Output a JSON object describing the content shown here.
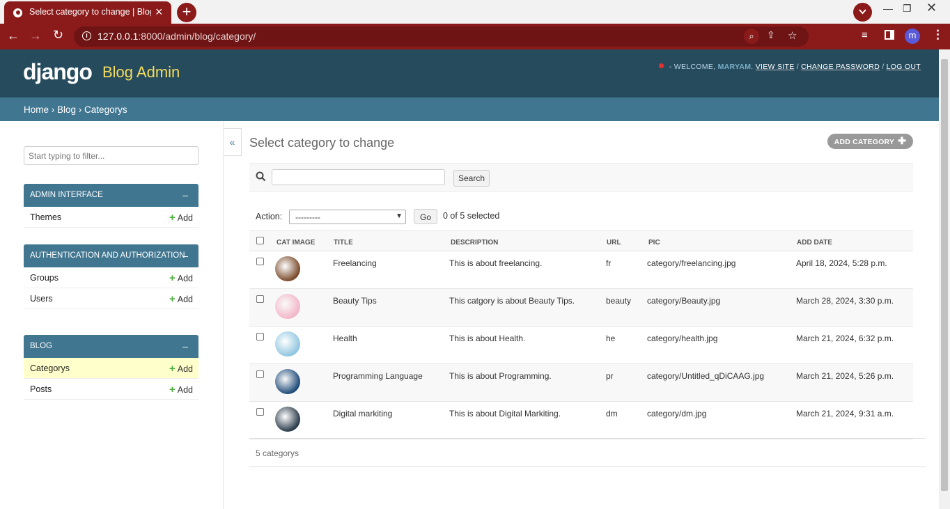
{
  "browser": {
    "tab_title": "Select category to change | Blog",
    "url_host": "127.0.0.1",
    "url_rest": ":8000/admin/blog/category/",
    "profile_initial": "m"
  },
  "header": {
    "brand": "django",
    "site_title": "Blog Admin",
    "welcome": "- Welcome,",
    "username": "maryam",
    "view_site": "View site",
    "change_password": "Change password",
    "logout": "Log out"
  },
  "breadcrumb": {
    "home": "Home",
    "app": "Blog",
    "current": "Categorys"
  },
  "sidebar": {
    "filter_placeholder": "Start typing to filter...",
    "add_label": "Add",
    "modules": [
      {
        "title": "ADMIN INTERFACE",
        "items": [
          "Themes"
        ]
      },
      {
        "title": "AUTHENTICATION AND AUTHORIZATION",
        "items": [
          "Groups",
          "Users"
        ]
      },
      {
        "title": "BLOG",
        "items": [
          "Categorys",
          "Posts"
        ]
      }
    ],
    "collapse": "«"
  },
  "content": {
    "title": "Select category to change",
    "add_button": "ADD CATEGORY",
    "search_button": "Search",
    "action_label": "Action:",
    "action_value": "---------",
    "go_button": "Go",
    "selected_count": "0 of 5 selected",
    "columns": [
      "CAT IMAGE",
      "TITLE",
      "DESCRIPTION",
      "URL",
      "PIC",
      "ADD DATE"
    ],
    "rows": [
      {
        "title": "Freelancing",
        "description": "This is about freelancing.",
        "url": "fr",
        "pic": "category/freelancing.jpg",
        "date": "April 18, 2024, 5:28 p.m.",
        "img_color": "#7a4a2a"
      },
      {
        "title": "Beauty Tips",
        "description": "This catgory is about Beauty Tips.",
        "url": "beauty",
        "pic": "category/Beauty.jpg",
        "date": "March 28, 2024, 3:30 p.m.",
        "img_color": "#f2b6c8"
      },
      {
        "title": "Health",
        "description": "This is about Health.",
        "url": "he",
        "pic": "category/health.jpg",
        "date": "March 21, 2024, 6:32 p.m.",
        "img_color": "#8fc6e0"
      },
      {
        "title": "Programming Language",
        "description": "This is about Programming.",
        "url": "pr",
        "pic": "category/Untitled_qDiCAAG.jpg",
        "date": "March 21, 2024, 5:26 p.m.",
        "img_color": "#1e4a78"
      },
      {
        "title": "Digital markiting",
        "description": "This is about Digital Markiting.",
        "url": "dm",
        "pic": "category/dm.jpg",
        "date": "March 21, 2024, 9:31 a.m.",
        "img_color": "#2a3a4a"
      }
    ],
    "paginator": "5 categorys"
  }
}
